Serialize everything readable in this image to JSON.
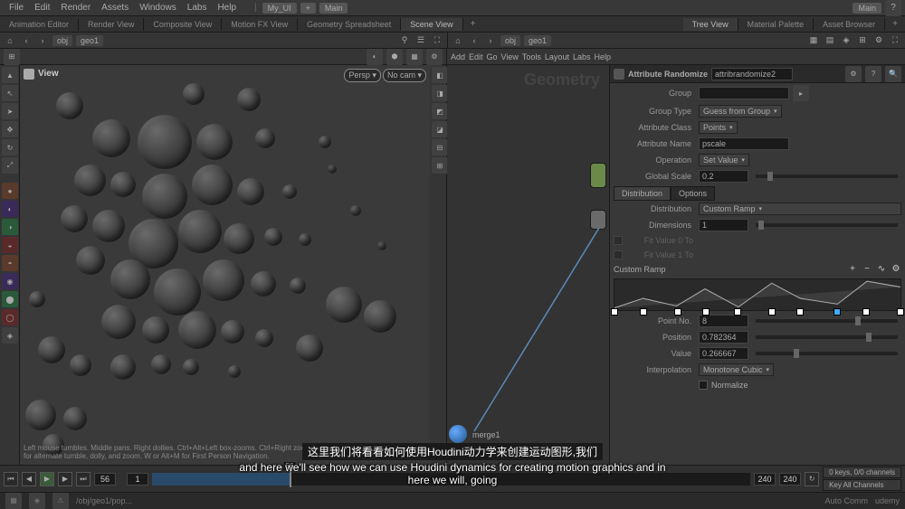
{
  "menubar": {
    "items": [
      "File",
      "Edit",
      "Render",
      "Assets",
      "Windows",
      "Labs",
      "Help"
    ],
    "desktop_label": "My_UI",
    "plus": "+",
    "main_label": "Main"
  },
  "tabbar": {
    "tabs": [
      "Animation Editor",
      "Render View",
      "Composite View",
      "Motion FX View",
      "Geometry Spreadsheet",
      "Scene View"
    ],
    "active": 5,
    "right_tabs": [
      "Tree View",
      "Material Palette",
      "Asset Browser"
    ]
  },
  "left_path": {
    "root": "obj",
    "node": "geo1"
  },
  "right_path": {
    "root": "obj",
    "node": "geo1"
  },
  "viewport": {
    "label": "View",
    "camera": "Persp",
    "nocam": "No cam",
    "hint": "Left mouse tumbles. Middle pans. Right dollies. Ctrl+Alt+Left box-zooms. Ctrl+Right zooms. Spacebar+Ctrl+Left tilts. Hold L for alternate tumble, dolly, and zoom. W or Alt+M for First Person Navigation."
  },
  "network": {
    "menubar": [
      "Add",
      "Edit",
      "Go",
      "View",
      "Tools",
      "Layout",
      "Labs",
      "Help"
    ],
    "bg_text": "Geometry",
    "merge_label": "merge1",
    "path": "/obj/geo1"
  },
  "params": {
    "node_type": "Attribute Randomize",
    "node_name": "attribrandomize2",
    "rows": {
      "group_label": "Group",
      "group_value": "",
      "group_type_label": "Group Type",
      "group_type_value": "Guess from Group",
      "attr_class_label": "Attribute Class",
      "attr_class_value": "Points",
      "attr_name_label": "Attribute Name",
      "attr_name_value": "pscale",
      "operation_label": "Operation",
      "operation_value": "Set Value",
      "global_scale_label": "Global Scale",
      "global_scale_value": "0.2",
      "distribution_tab": "Distribution",
      "options_tab": "Options",
      "distribution_label": "Distribution",
      "distribution_value": "Custom Ramp",
      "dimensions_label": "Dimensions",
      "dimensions_value": "1",
      "fit0_label": "Fit Value 0 To",
      "fit1_label": "Fit Value 1 To",
      "ramp_label": "Custom Ramp",
      "point_no_label": "Point No.",
      "point_no_value": "8",
      "position_label": "Position",
      "position_value": "0.782364",
      "value_label": "Value",
      "value_value": "0.266667",
      "interp_label": "Interpolation",
      "interp_value": "Monotone Cubic",
      "normalize_label": "Normalize"
    }
  },
  "timeline": {
    "frame_start": "1",
    "frame_current": "56",
    "frame_end": "240",
    "frame_end2": "240",
    "keys_info": "0 keys, 0/0 channels",
    "key_all": "Key All Channels",
    "auto": "Auto Comm",
    "progress_pct": 23
  },
  "status": {
    "path": "/obj/geo1/pop...",
    "watermark": "udemy"
  },
  "subtitle": {
    "cn": "这里我们将看看如何使用Houdini动力学来创建运动图形,我们",
    "en": "and here we'll see how we can use Houdini dynamics for creating motion graphics and in here we will, going"
  }
}
